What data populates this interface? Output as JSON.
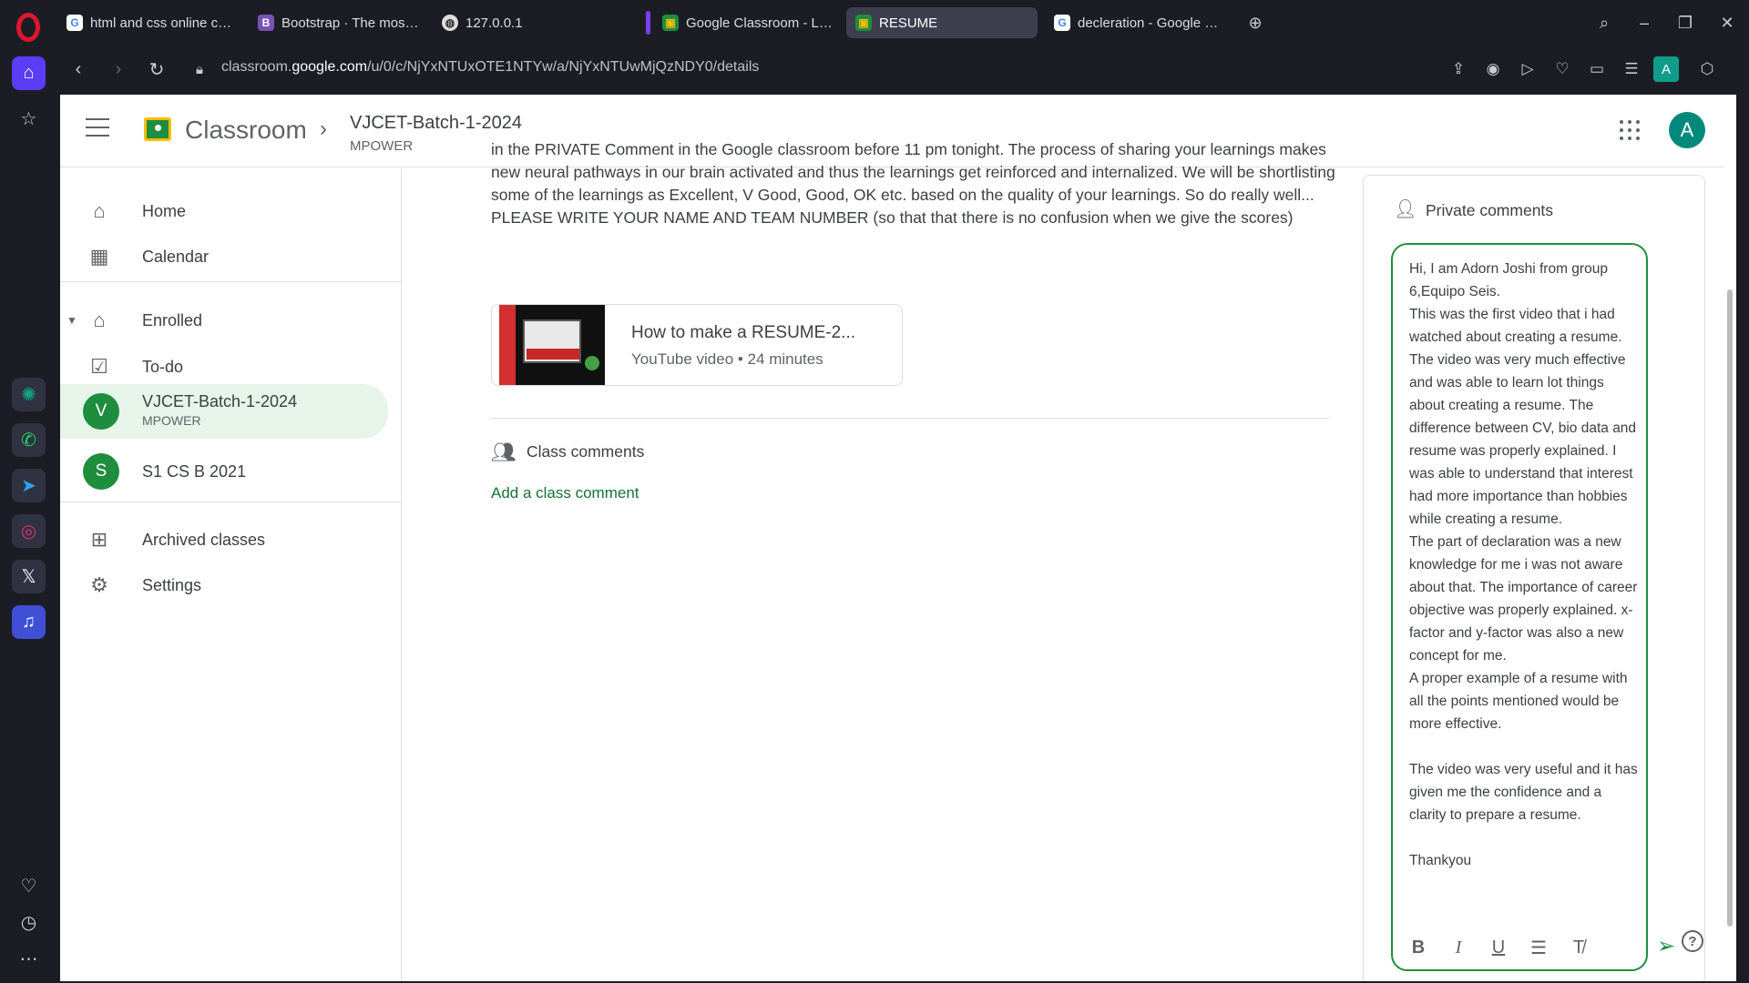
{
  "browser": {
    "tabs": [
      {
        "label": "html and css online course",
        "icon": "google-icon",
        "color": "#ffffff"
      },
      {
        "label": "Bootstrap · The most popular",
        "icon": "bootstrap-icon",
        "color": "#7952b3"
      },
      {
        "label": "127.0.0.1",
        "icon": "globe-icon",
        "color": "#ffffff"
      },
      {
        "label": "Google Classroom - Login",
        "icon": "classroom-icon",
        "color": "#1e8e3e"
      },
      {
        "label": "RESUME",
        "icon": "classroom-icon",
        "color": "#1e8e3e"
      },
      {
        "label": "decleration - Google Search",
        "icon": "google-icon",
        "color": "#ffffff"
      }
    ],
    "url_prefix": "classroom.",
    "url_host": "google.com",
    "url_path": "/u/0/c/NjYxNTUxOTE1NTYw/a/NjYxNTUwMjQzNDY0/details",
    "profile_initial": "A"
  },
  "header": {
    "app_title": "Classroom",
    "class_name": "VJCET-Batch-1-2024",
    "section": "MPOWER",
    "avatar_initial": "A",
    "avatar_color": "#00897b"
  },
  "leftnav": {
    "home": "Home",
    "calendar": "Calendar",
    "enrolled": "Enrolled",
    "todo": "To-do",
    "classes": [
      {
        "initial": "V",
        "name": "VJCET-Batch-1-2024",
        "section": "MPOWER"
      },
      {
        "initial": "S",
        "name": "S1 CS B 2021",
        "section": ""
      }
    ],
    "archived": "Archived classes",
    "settings": "Settings"
  },
  "assignment": {
    "line1": "in the PRIVATE Comment in the Google classroom before 11 pm tonight. The process of sharing your learnings makes new neural pathways in our brain activated and thus the learnings get reinforced and internalized. We will be shortlisting some of the learnings as Excellent, V Good, Good, OK etc. based on the quality of your learnings. So do really well...",
    "line2": "PLEASE WRITE YOUR NAME AND TEAM NUMBER (so that that there is no confusion when we give the scores)",
    "video_title": "How to make a RESUME-2...",
    "video_meta": "YouTube video • 24 minutes",
    "class_comments": "Class comments",
    "add_comment": "Add a class comment"
  },
  "private_comments": {
    "title": "Private comments",
    "draft": "Hi, I am Adorn Joshi from group 6,Equipo Seis.\nThis was the first video that i had watched about creating a resume. The video was very much effective and was able to learn lot things about creating a resume. The difference between CV, bio data and resume was properly explained. I was able to understand that interest had more importance than hobbies while creating a resume.\nThe part of declaration was a new knowledge for me i was not aware about that. The importance of career objective was properly explained. x-factor and y-factor was also a new concept for me.\nA proper example of a resume with all the points mentioned would be more effective.\n\nThe video was very useful and it has given me the confidence and a clarity to prepare a resume.\n\nThankyou",
    "toolbar": [
      "bold",
      "italic",
      "underline",
      "bulleted-list",
      "clear-formatting"
    ]
  }
}
